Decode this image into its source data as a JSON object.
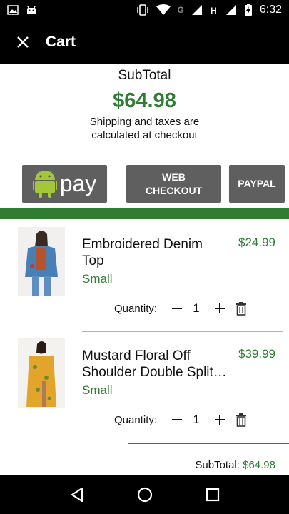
{
  "status_bar": {
    "time": "6:32",
    "network": "G",
    "icons": [
      "image-icon",
      "android-icon",
      "vibrate-icon",
      "wifi-icon",
      "signal-icon",
      "h-icon",
      "signal-icon",
      "battery-charging-icon"
    ]
  },
  "app_bar": {
    "title": "Cart",
    "close_icon": "close-icon"
  },
  "summary": {
    "label": "SubTotal",
    "amount": "$64.98",
    "note_line1": "Shipping and taxes are",
    "note_line2": "calculated at checkout"
  },
  "payment": {
    "gpay_label": "pay",
    "web_checkout_line1": "WEB",
    "web_checkout_line2": "CHECKOUT",
    "paypal_label": "PAYPAL"
  },
  "items": [
    {
      "name_line1": "Embroidered Denim",
      "name_line2": "Top",
      "size": "Small",
      "price": "$24.99",
      "quantity_label": "Quantity:",
      "quantity": "1"
    },
    {
      "name_line1": "Mustard Floral Off",
      "name_line2": "Shoulder Double Split…",
      "size": "Small",
      "price": "$39.99",
      "quantity_label": "Quantity:",
      "quantity": "1"
    }
  ],
  "footer": {
    "subtotal_label": "SubTotal:",
    "subtotal_amount": "$64.98"
  },
  "colors": {
    "accent": "#2e7d32",
    "button_gray": "#5f5f5f",
    "divider_teal": "#80cbc4"
  }
}
